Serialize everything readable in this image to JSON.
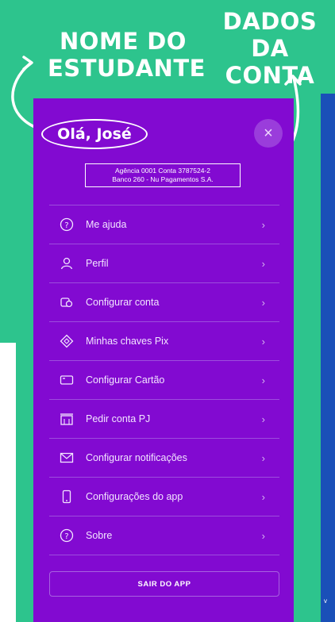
{
  "annotations": {
    "student_name_line1": "NOME DO",
    "student_name_line2": "ESTUDANTE",
    "account_data_line1": "DADOS DA",
    "account_data_line2": "CONTA"
  },
  "header": {
    "greeting": "Olá, José",
    "close_symbol": "×",
    "account_line1": "Agência 0001 Conta 3787524-2",
    "account_line2": "Banco 260 - Nu Pagamentos S.A."
  },
  "menu": {
    "items": [
      {
        "label": "Me ajuda",
        "icon": "help-icon"
      },
      {
        "label": "Perfil",
        "icon": "profile-icon"
      },
      {
        "label": "Configurar conta",
        "icon": "account-settings-icon"
      },
      {
        "label": "Minhas chaves Pix",
        "icon": "pix-icon"
      },
      {
        "label": "Configurar Cartão",
        "icon": "card-icon"
      },
      {
        "label": "Pedir conta PJ",
        "icon": "business-account-icon"
      },
      {
        "label": "Configurar notificações",
        "icon": "notification-icon"
      },
      {
        "label": "Configurações do app",
        "icon": "phone-icon"
      },
      {
        "label": "Sobre",
        "icon": "info-icon"
      }
    ],
    "chevron": "›"
  },
  "logout_label": "SAIR DO APP",
  "colors": {
    "background_green": "#2dc48d",
    "panel_purple": "#820ad1",
    "right_panel_blue": "#1a50b8"
  }
}
